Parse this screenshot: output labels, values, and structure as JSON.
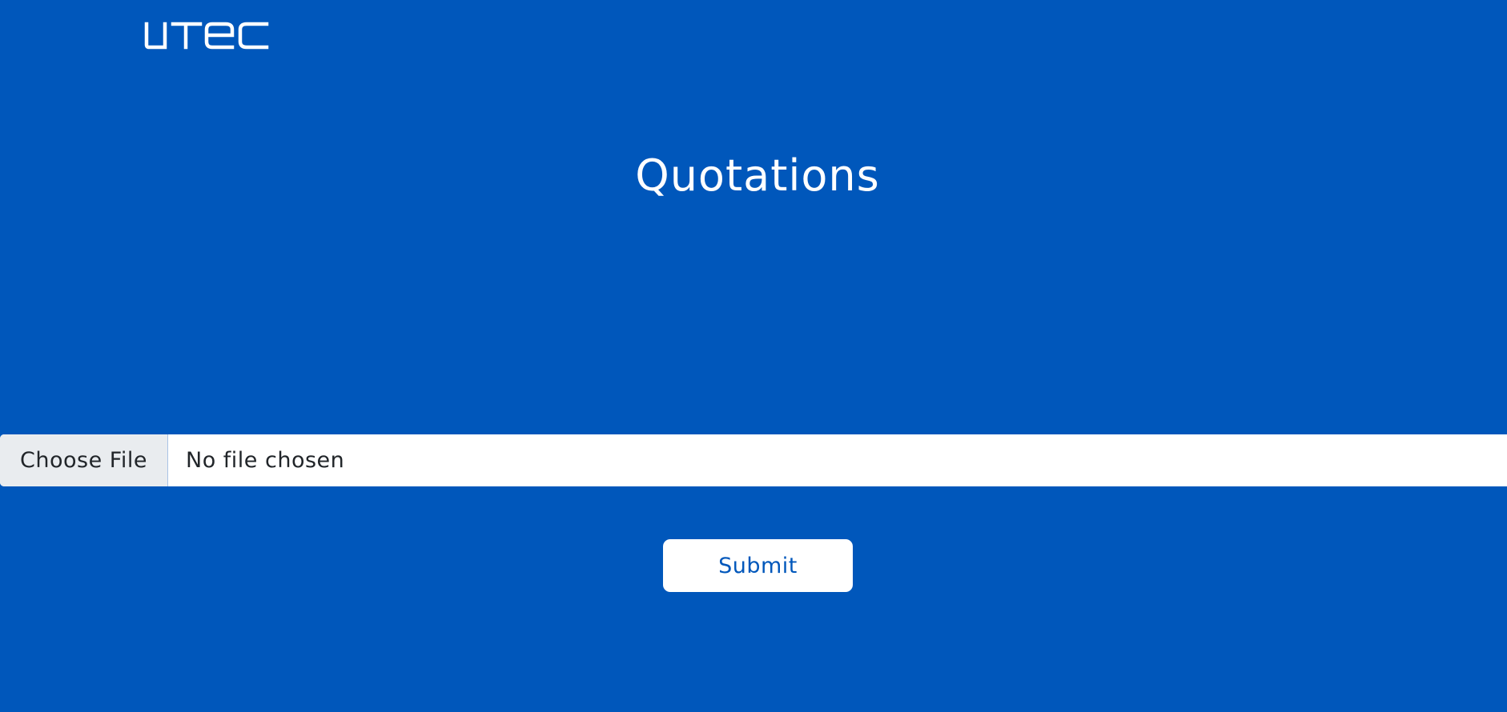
{
  "header": {
    "logo_text": "UTEC"
  },
  "main": {
    "title": "Quotations"
  },
  "upload": {
    "choose_label": "Choose File",
    "status_text": "No file chosen"
  },
  "form": {
    "submit_label": "Submit"
  },
  "colors": {
    "background": "#0057bb",
    "button_bg": "#ffffff",
    "button_text": "#0057bb",
    "choose_bg": "#e9ecef",
    "text_dark": "#212529"
  }
}
